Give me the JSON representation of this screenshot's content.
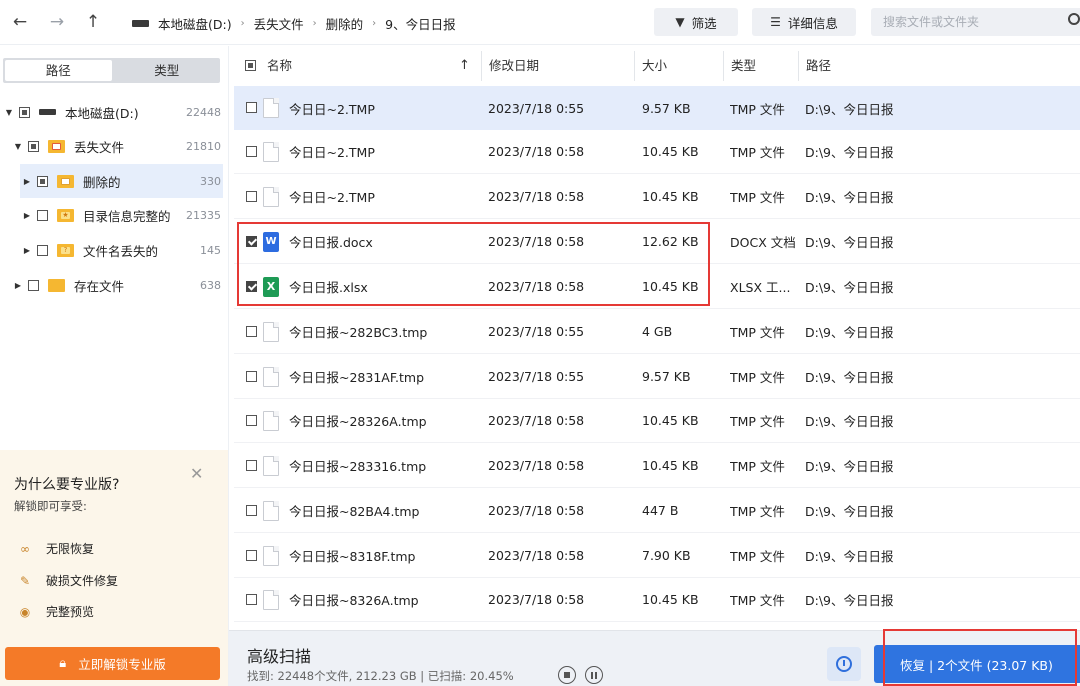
{
  "topbar": {
    "back_icon": "←",
    "forward_icon": "→",
    "up_icon": "↑",
    "breadcrumb": [
      "本地磁盘(D:)",
      "丢失文件",
      "删除的",
      "9、今日日报"
    ],
    "filter_label": "筛选",
    "details_label": "详细信息",
    "search_placeholder": "搜索文件或文件夹"
  },
  "sidebar": {
    "tab_path": "路径",
    "tab_type": "类型",
    "tree": [
      {
        "label": "本地磁盘(D:)",
        "count": "22448"
      },
      {
        "label": "丢失文件",
        "count": "21810"
      },
      {
        "label": "删除的",
        "count": "330"
      },
      {
        "label": "目录信息完整的",
        "count": "21335"
      },
      {
        "label": "文件名丢失的",
        "count": "145"
      },
      {
        "label": "存在文件",
        "count": "638"
      }
    ],
    "promo": {
      "title": "为什么要专业版?",
      "subtitle": "解锁即可享受:",
      "close_icon": "✕",
      "features": [
        "无限恢复",
        "破损文件修复",
        "完整预览"
      ],
      "unlock_label": "立即解锁专业版"
    }
  },
  "table": {
    "headers": {
      "name": "名称",
      "date": "修改日期",
      "size": "大小",
      "type": "类型",
      "path": "路径"
    },
    "sort_icon": "↑",
    "rows": [
      {
        "name": "今日日~2.TMP",
        "date": "2023/7/18 0:55",
        "size": "9.57 KB",
        "type": "TMP 文件",
        "path": "D:\\9、今日日报"
      },
      {
        "name": "今日日~2.TMP",
        "date": "2023/7/18 0:58",
        "size": "10.45 KB",
        "type": "TMP 文件",
        "path": "D:\\9、今日日报"
      },
      {
        "name": "今日日~2.TMP",
        "date": "2023/7/18 0:58",
        "size": "10.45 KB",
        "type": "TMP 文件",
        "path": "D:\\9、今日日报"
      },
      {
        "name": "今日日报.docx",
        "date": "2023/7/18 0:58",
        "size": "12.62 KB",
        "type": "DOCX 文档",
        "path": "D:\\9、今日日报"
      },
      {
        "name": "今日日报.xlsx",
        "date": "2023/7/18 0:58",
        "size": "10.45 KB",
        "type": "XLSX 工...",
        "path": "D:\\9、今日日报"
      },
      {
        "name": "今日日报~282BC3.tmp",
        "date": "2023/7/18 0:55",
        "size": "4 GB",
        "type": "TMP 文件",
        "path": "D:\\9、今日日报"
      },
      {
        "name": "今日日报~2831AF.tmp",
        "date": "2023/7/18 0:55",
        "size": "9.57 KB",
        "type": "TMP 文件",
        "path": "D:\\9、今日日报"
      },
      {
        "name": "今日日报~28326A.tmp",
        "date": "2023/7/18 0:58",
        "size": "10.45 KB",
        "type": "TMP 文件",
        "path": "D:\\9、今日日报"
      },
      {
        "name": "今日日报~283316.tmp",
        "date": "2023/7/18 0:58",
        "size": "10.45 KB",
        "type": "TMP 文件",
        "path": "D:\\9、今日日报"
      },
      {
        "name": "今日日报~82BA4.tmp",
        "date": "2023/7/18 0:58",
        "size": "447 B",
        "type": "TMP 文件",
        "path": "D:\\9、今日日报"
      },
      {
        "name": "今日日报~8318F.tmp",
        "date": "2023/7/18 0:58",
        "size": "7.90 KB",
        "type": "TMP 文件",
        "path": "D:\\9、今日日报"
      },
      {
        "name": "今日日报~8326A.tmp",
        "date": "2023/7/18 0:58",
        "size": "10.45 KB",
        "type": "TMP 文件",
        "path": "D:\\9、今日日报"
      }
    ]
  },
  "bottombar": {
    "scan_title": "高级扫描",
    "scan_status": "找到: 22448个文件, 212.23 GB | 已扫描: 20.45%",
    "recover_label": "恢复 | 2个文件 (23.07 KB)"
  },
  "colors": {
    "accent": "#2f74e0",
    "unlock": "#f47a28",
    "annotation": "#e53935",
    "promo_bg": "#fcf6ea"
  }
}
